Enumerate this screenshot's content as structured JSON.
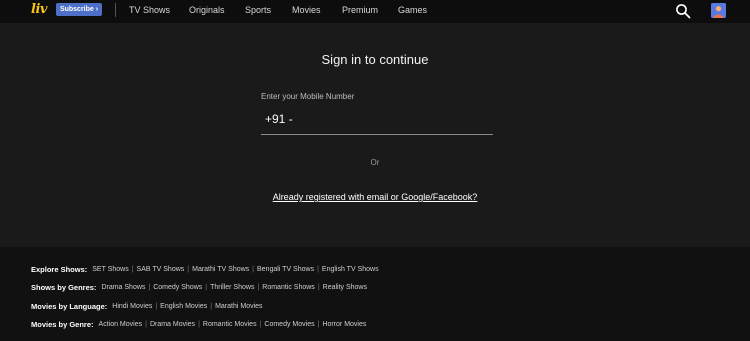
{
  "header": {
    "logo": "liv",
    "subscribe_label": "Subscribe ›",
    "nav": [
      "TV Shows",
      "Originals",
      "Sports",
      "Movies",
      "Premium",
      "Games"
    ]
  },
  "main": {
    "title": "Sign in to continue",
    "mobile_label": "Enter your Mobile Number",
    "country_code": "+91 -",
    "or_text": "Or",
    "alt_link": "Already registered with email or Google/Facebook?"
  },
  "footer": {
    "rows": [
      {
        "label": "Explore Shows:",
        "links": [
          "SET Shows",
          "SAB TV Shows",
          "Marathi TV Shows",
          "Bengali TV Shows",
          "English TV Shows"
        ]
      },
      {
        "label": "Shows by Genres:",
        "links": [
          "Drama Shows",
          "Comedy Shows",
          "Thriller Shows",
          "Romantic Shows",
          "Reality Shows"
        ]
      },
      {
        "label": "Movies by Language:",
        "links": [
          "Hindi Movies",
          "English Movies",
          "Marathi Movies"
        ]
      },
      {
        "label": "Movies by Genre:",
        "links": [
          "Action Movies",
          "Drama Movies",
          "Romantic Movies",
          "Comedy Movies",
          "Horror Movies"
        ]
      }
    ]
  },
  "colors": {
    "background": "#1a1a1a",
    "header": "#0d0d0d",
    "subscribe": "#4d6fc7",
    "logo": "#f5c518"
  },
  "icons": [
    "search-icon",
    "avatar"
  ]
}
